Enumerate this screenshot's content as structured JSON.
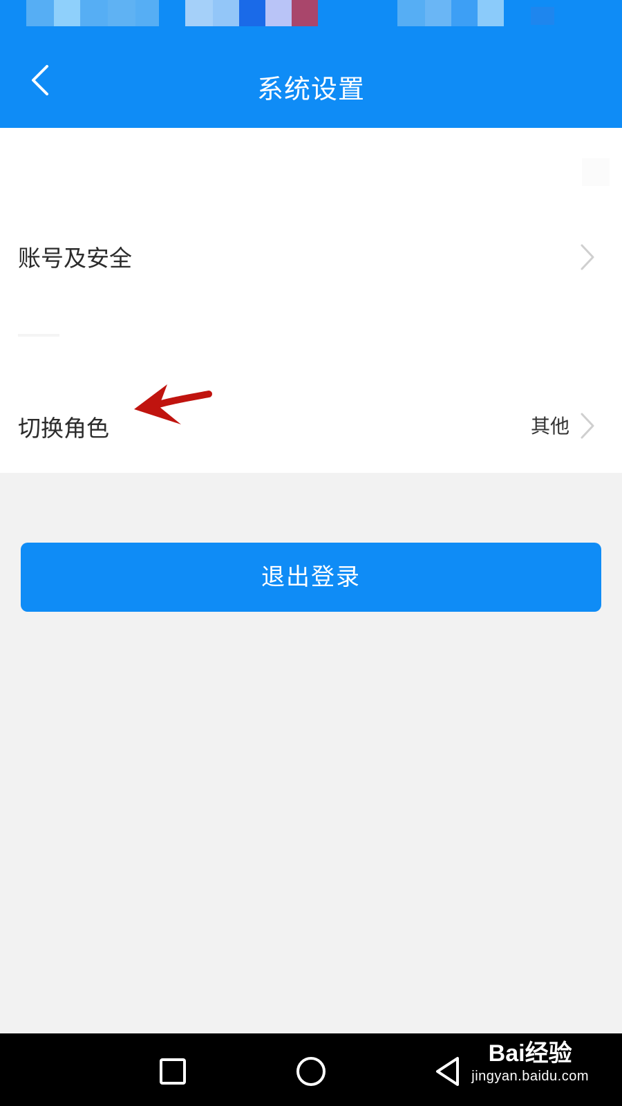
{
  "header": {
    "title": "系统设置",
    "back_icon": "chevron-left-icon"
  },
  "settings": {
    "items": [
      {
        "label": "账号及安全",
        "value": "",
        "icon": "chevron-right-icon"
      },
      {
        "label": "切换角色",
        "value": "其他",
        "icon": "chevron-right-icon"
      }
    ]
  },
  "logout": {
    "label": "退出登录"
  },
  "navbar": {
    "icons": [
      "square-recent-apps-icon",
      "circle-home-icon",
      "triangle-back-icon"
    ]
  },
  "watermark": {
    "logo": "Bai经验",
    "url": "jingyan.baidu.com"
  },
  "colors": {
    "primary": "#0f8cf6",
    "annotation": "#c0140f",
    "background": "#f2f2f2"
  }
}
